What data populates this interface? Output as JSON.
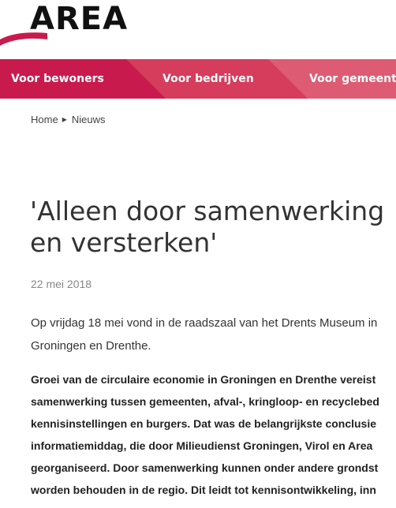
{
  "header": {
    "logo_text": "AREA",
    "brand_color": "#c91a4e"
  },
  "nav": {
    "items": [
      {
        "label": "Voor bewoners"
      },
      {
        "label": "Voor bedrijven"
      },
      {
        "label": "Voor gemeenten"
      }
    ],
    "colors": [
      "#c91a4e",
      "#d63c5b",
      "#dd5c73"
    ]
  },
  "breadcrumb": {
    "home": "Home",
    "current": "Nieuws",
    "separator_icon": "caret-right-icon"
  },
  "article": {
    "title_lines": [
      "'Alleen door samenwerking",
      "en versterken'"
    ],
    "date": "22 mei 2018",
    "intro_lines": [
      "Op vrijdag 18 mei vond in de raadszaal van het Drents Museum in",
      "Groningen en Drenthe."
    ],
    "lead_lines": [
      "Groei van de circulaire economie in Groningen en Drenthe vereist",
      "samenwerking tussen gemeenten, afval-, kringloop- en recyclebed",
      "kennisinstellingen en burgers. Dat was de belangrijkste conclusie",
      "informatiemiddag, die door Milieudienst Groningen, Virol en Area",
      "georganiseerd. Door samenwerking kunnen onder andere grondst",
      "worden behouden in de regio. Dit leidt tot kennisontwikkeling, inn"
    ]
  }
}
